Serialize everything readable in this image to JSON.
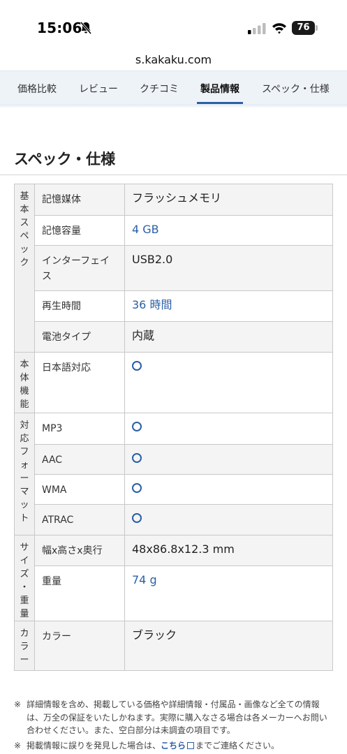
{
  "status_bar": {
    "time": "15:06",
    "battery": "76"
  },
  "browser": {
    "url": "s.kakaku.com"
  },
  "tabs": [
    {
      "label": "価格比較"
    },
    {
      "label": "レビュー"
    },
    {
      "label": "クチコミ"
    },
    {
      "label": "製品情報",
      "active": true
    },
    {
      "label": "スペック・仕様"
    }
  ],
  "section": {
    "title": "スペック・仕様"
  },
  "spec": {
    "basic": {
      "category": [
        "基",
        "本",
        "ス",
        "ペ",
        "ッ",
        "ク"
      ],
      "rows": [
        {
          "key": "記憶媒体",
          "value": "フラッシュメモリ"
        },
        {
          "key": "記憶容量",
          "value": "4 GB"
        },
        {
          "key": "インターフェイス",
          "value": "USB2.0"
        },
        {
          "key": "再生時間",
          "value": "36 時間"
        },
        {
          "key": "電池タイプ",
          "value": "内蔵"
        }
      ]
    },
    "functions": {
      "category": [
        "本",
        "体",
        "機",
        "能"
      ],
      "rows": [
        {
          "key": "日本語対応",
          "value": "○"
        }
      ]
    },
    "formats": {
      "category": [
        "対",
        "応",
        "フ",
        "ォ",
        "ー",
        "マ",
        "ッ",
        "ト"
      ],
      "rows": [
        {
          "key": "MP3",
          "value": "○"
        },
        {
          "key": "AAC",
          "value": "○"
        },
        {
          "key": "WMA",
          "value": "○"
        },
        {
          "key": "ATRAC",
          "value": "○"
        }
      ]
    },
    "size": {
      "category": [
        "サ",
        "イ",
        "ズ",
        "・",
        "重",
        "量"
      ],
      "rows": [
        {
          "key": "幅x高さx奥行",
          "value": "48x86.8x12.3 mm"
        },
        {
          "key": "重量",
          "value": "74 g"
        }
      ]
    },
    "color": {
      "category": [
        "カ",
        "ラ",
        "ー"
      ],
      "rows": [
        {
          "key": "カラー",
          "value": "ブラック"
        }
      ]
    }
  },
  "notes": {
    "note1": "詳細情報を含め、掲載している価格や詳細情報・付属品・画像など全ての情報は、万全の保証をいたしかねます。実際に購入なさる場合は各メーカーへお問い合わせください。また、空白部分は未調査の項目です。",
    "note2_before": "掲載情報に誤りを発見した場合は、",
    "note2_link": "こちら",
    "note2_after": "までご連絡ください。",
    "mark": "※"
  },
  "colors": {
    "accent": "#2a5fa6",
    "tab_bg": "#eef3f8",
    "cat_bg": "#f0f0f0"
  }
}
